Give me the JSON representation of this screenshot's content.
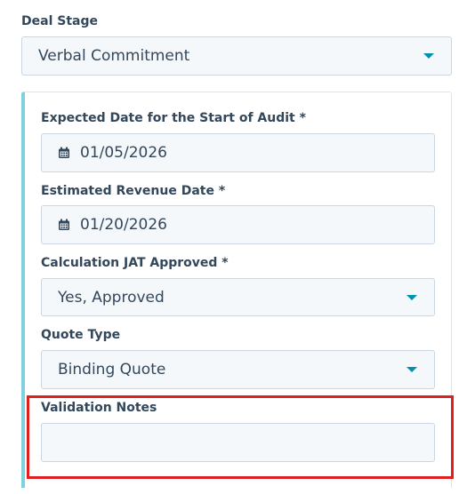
{
  "deal_stage": {
    "label": "Deal Stage",
    "value": "Verbal Commitment"
  },
  "audit_start": {
    "label": "Expected Date for the Start of Audit *",
    "value": "01/05/2026",
    "icon": "calendar-icon"
  },
  "revenue_date": {
    "label": "Estimated Revenue Date *",
    "value": "01/20/2026",
    "icon": "calendar-icon"
  },
  "jat_approved": {
    "label": "Calculation JAT Approved *",
    "value": "Yes, Approved"
  },
  "quote_type": {
    "label": "Quote Type",
    "value": "Binding Quote"
  },
  "validation_notes": {
    "label": "Validation Notes",
    "value": ""
  },
  "colors": {
    "accent": "#0091ae",
    "panel_stripe": "#7fd1de",
    "highlight": "#e02020",
    "field_bg": "#f5f8fa",
    "field_border": "#cbd6e2",
    "text": "#33475b"
  }
}
